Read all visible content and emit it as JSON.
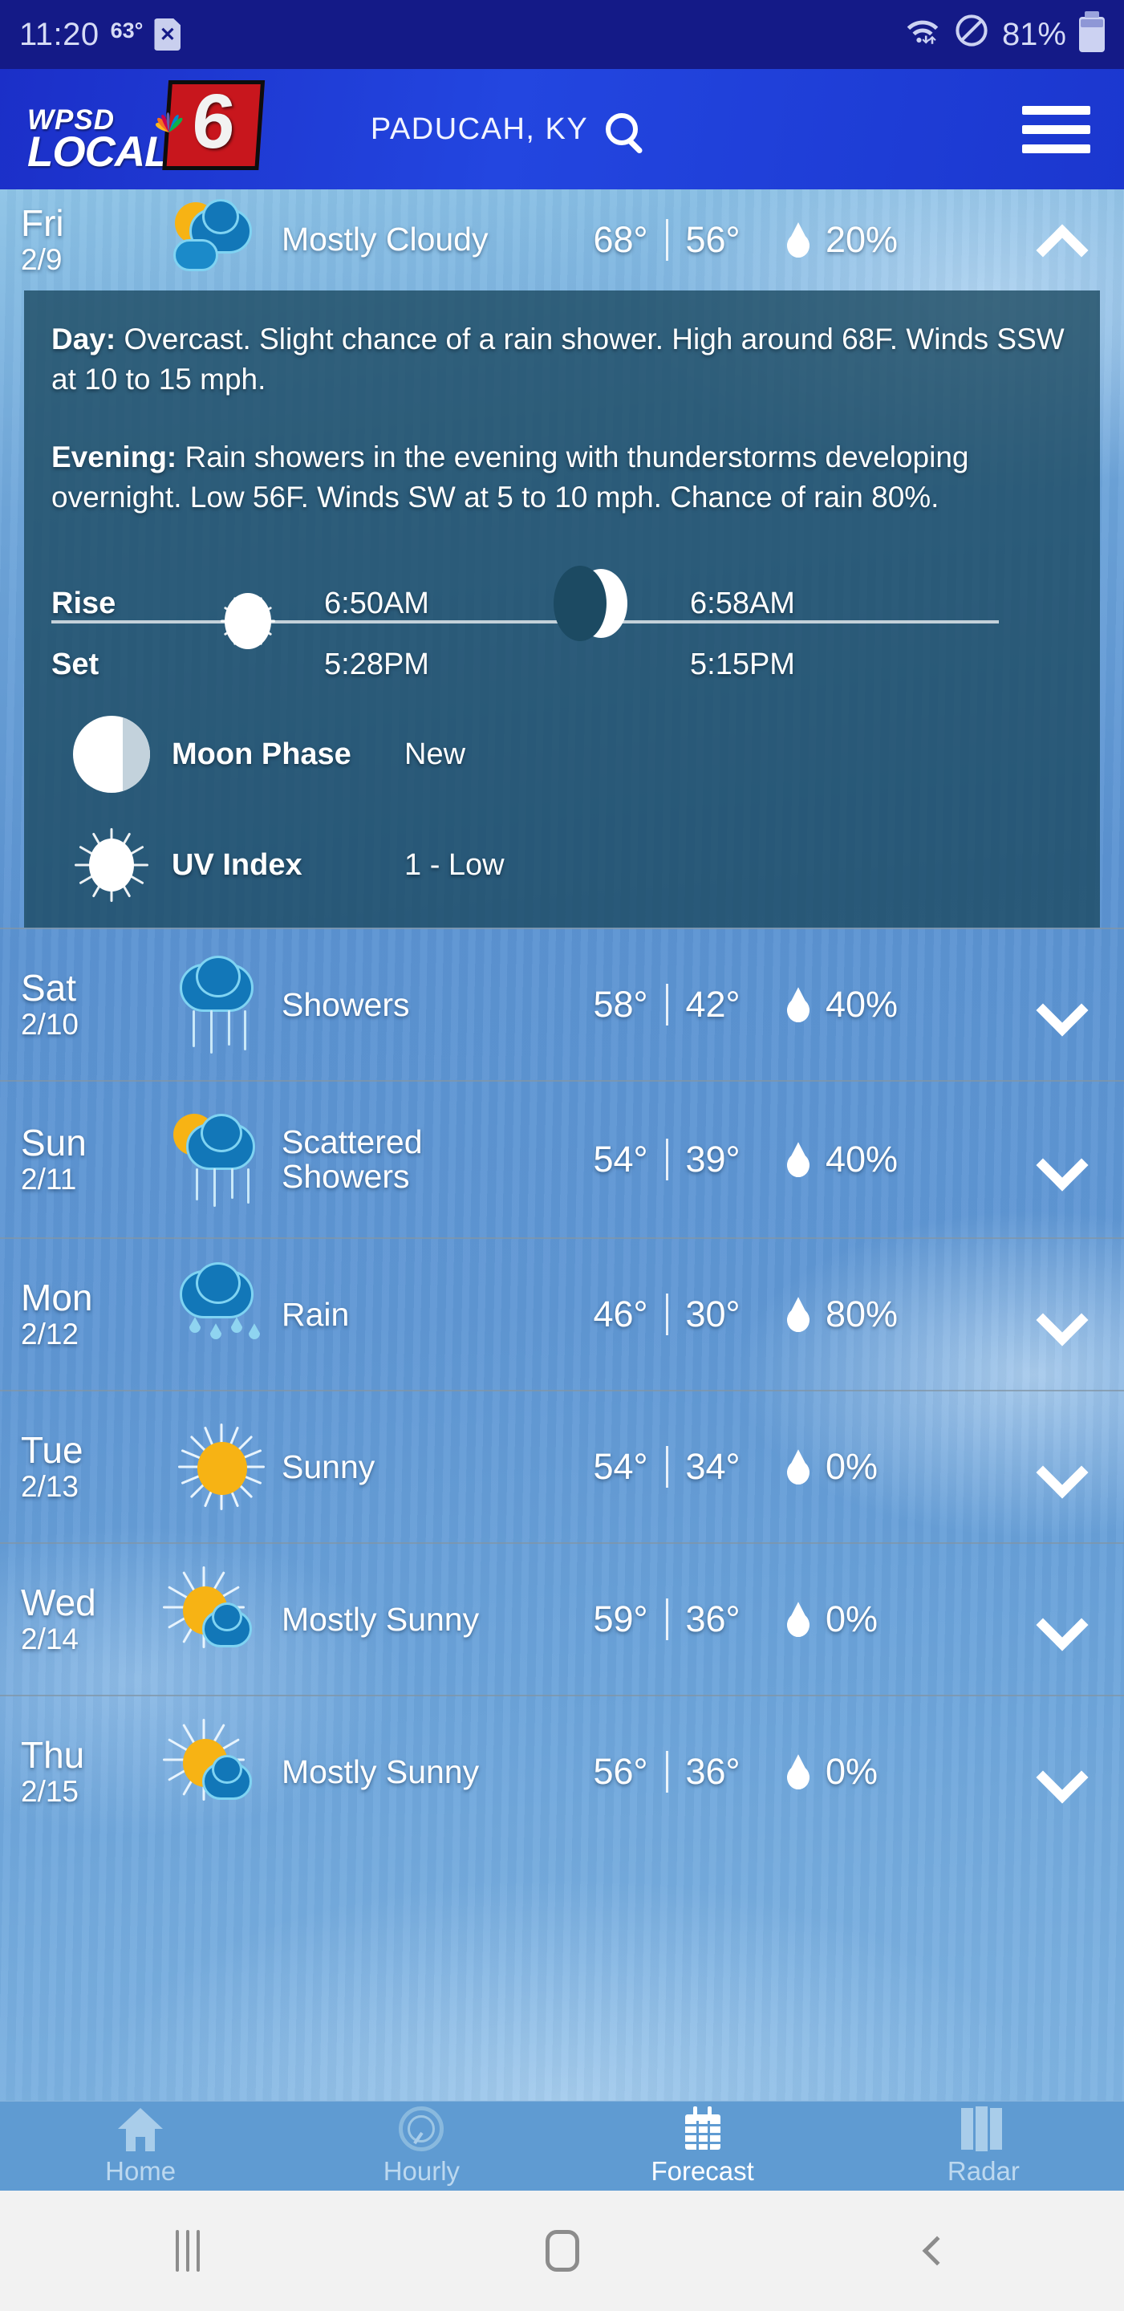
{
  "status_bar": {
    "time": "11:20",
    "temperature": "63°",
    "sim_icon": "sim-card-x-icon",
    "wifi_icon": "wifi-icon",
    "dnd_icon": "do-not-disturb-icon",
    "battery_percent": "81%",
    "battery_icon": "battery-icon"
  },
  "header": {
    "logo_line1": "WPSD",
    "logo_line2": "LOCAL",
    "logo_six": "6",
    "location": "PADUCAH, KY",
    "search_icon": "search-icon",
    "menu_icon": "hamburger-menu-icon"
  },
  "forecast": {
    "days": [
      {
        "dow": "Fri",
        "date": "2/9",
        "condition": "Mostly Cloudy",
        "icon": "sun-behind-cloud-icon",
        "high": "68°",
        "low": "56°",
        "pop": "20%",
        "chevron": "chevron-up-icon",
        "expanded": true
      },
      {
        "dow": "Sat",
        "date": "2/10",
        "condition": "Showers",
        "icon": "rain-cloud-icon",
        "high": "58°",
        "low": "42°",
        "pop": "40%",
        "chevron": "chevron-down-icon",
        "expanded": false
      },
      {
        "dow": "Sun",
        "date": "2/11",
        "condition": "Scattered Showers",
        "icon": "sun-behind-rain-cloud-icon",
        "high": "54°",
        "low": "39°",
        "pop": "40%",
        "chevron": "chevron-down-icon",
        "expanded": false
      },
      {
        "dow": "Mon",
        "date": "2/12",
        "condition": "Rain",
        "icon": "rain-drops-cloud-icon",
        "high": "46°",
        "low": "30°",
        "pop": "80%",
        "chevron": "chevron-down-icon",
        "expanded": false
      },
      {
        "dow": "Tue",
        "date": "2/13",
        "condition": "Sunny",
        "icon": "sun-icon",
        "high": "54°",
        "low": "34°",
        "pop": "0%",
        "chevron": "chevron-down-icon",
        "expanded": false
      },
      {
        "dow": "Wed",
        "date": "2/14",
        "condition": "Mostly Sunny",
        "icon": "sun-behind-small-cloud-icon",
        "high": "59°",
        "low": "36°",
        "pop": "0%",
        "chevron": "chevron-down-icon",
        "expanded": false
      },
      {
        "dow": "Thu",
        "date": "2/15",
        "condition": "Mostly Sunny",
        "icon": "sun-behind-small-cloud-icon",
        "high": "56°",
        "low": "36°",
        "pop": "0%",
        "chevron": "chevron-down-icon",
        "expanded": false
      }
    ],
    "detail": {
      "day_label": "Day:",
      "day_text": "Overcast. Slight chance of a rain shower. High around 68F. Winds SSW at 10 to 15 mph.",
      "evening_label": "Evening:",
      "evening_text": "Rain showers in the evening with thunderstorms developing overnight. Low 56F. Winds SW at 5 to 10 mph. Chance of rain 80%.",
      "rise_label": "Rise",
      "set_label": "Set",
      "sunrise": "6:50AM",
      "sunset": "5:28PM",
      "moonrise": "6:58AM",
      "moonset": "5:15PM",
      "sun_icon": "sun-icon",
      "moon_icon": "crescent-moon-icon",
      "moon_phase_label": "Moon Phase",
      "moon_phase_value": "New",
      "moon_phase_icon": "moon-phase-icon",
      "uv_label": "UV Index",
      "uv_value": "1 - Low",
      "uv_icon": "uv-sun-icon"
    }
  },
  "tabbar": {
    "tabs": [
      {
        "label": "Home",
        "icon": "home-icon",
        "active": false
      },
      {
        "label": "Hourly",
        "icon": "clock-icon",
        "active": false
      },
      {
        "label": "Forecast",
        "icon": "calendar-icon",
        "active": true
      },
      {
        "label": "Radar",
        "icon": "map-icon",
        "active": false
      }
    ]
  },
  "system_nav": {
    "recents_icon": "recents-icon",
    "home_icon": "home-pill-icon",
    "back_icon": "back-chevron-icon"
  },
  "colors": {
    "status_bar_bg": "#141a87",
    "header_bg": "#2346e0",
    "accent_sun": "#f7b314",
    "accent_cloud": "#1277b8",
    "detail_panel_bg": "#1c4a62",
    "tabbar_bg": "#5f9bd2"
  }
}
